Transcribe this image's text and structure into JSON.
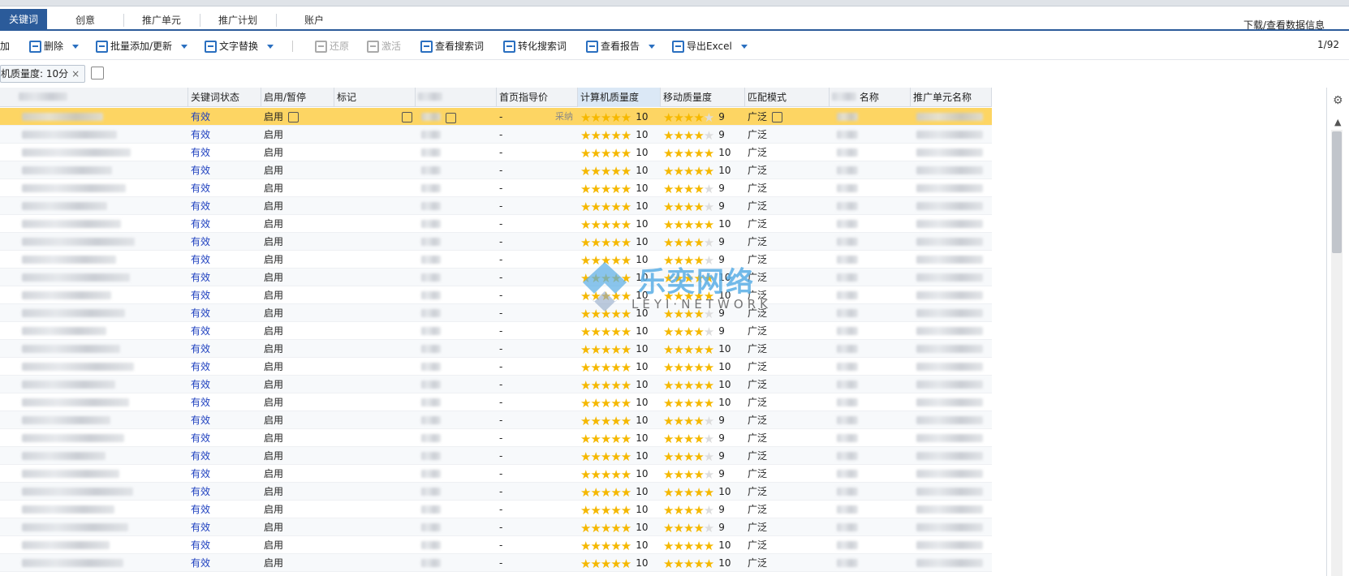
{
  "tabs": [
    {
      "label": "关键词",
      "active": true
    },
    {
      "label": "创意"
    },
    {
      "label": "推广单元"
    },
    {
      "label": "推广计划"
    },
    {
      "label": "账户"
    }
  ],
  "download_link": "下载/查看数据信息",
  "toolbar": {
    "add": "加",
    "delete": "删除",
    "batch_add": "批量添加/更新",
    "text_replace": "文字替换",
    "restore": "还原",
    "activate": "激活",
    "view_search": "查看搜索词",
    "convert_search": "转化搜索词",
    "view_report": "查看报告",
    "export": "导出Excel",
    "pager": "1/92"
  },
  "filter": {
    "chip": "机质量度: 10分",
    "close": "×"
  },
  "columns": {
    "status": "关键词状态",
    "enable": "启用/暂停",
    "mark": "标记",
    "bid_guide": "首页指导价",
    "pc_quality": "计算机质量度",
    "mobile_quality": "移动质量度",
    "match": "匹配模式",
    "plan": "名称",
    "unit": "推广单元名称"
  },
  "rows": [
    {
      "status": "有效",
      "enable": "启用",
      "bid": "-",
      "pc": 10,
      "mobile": 9,
      "match": "广泛",
      "selected": true,
      "note": "采纳"
    },
    {
      "status": "有效",
      "enable": "启用",
      "bid": "-",
      "pc": 10,
      "mobile": 9,
      "match": "广泛"
    },
    {
      "status": "有效",
      "enable": "启用",
      "bid": "-",
      "pc": 10,
      "mobile": 10,
      "match": "广泛"
    },
    {
      "status": "有效",
      "enable": "启用",
      "bid": "-",
      "pc": 10,
      "mobile": 10,
      "match": "广泛"
    },
    {
      "status": "有效",
      "enable": "启用",
      "bid": "-",
      "pc": 10,
      "mobile": 9,
      "match": "广泛"
    },
    {
      "status": "有效",
      "enable": "启用",
      "bid": "-",
      "pc": 10,
      "mobile": 9,
      "match": "广泛"
    },
    {
      "status": "有效",
      "enable": "启用",
      "bid": "-",
      "pc": 10,
      "mobile": 10,
      "match": "广泛"
    },
    {
      "status": "有效",
      "enable": "启用",
      "bid": "-",
      "pc": 10,
      "mobile": 9,
      "match": "广泛"
    },
    {
      "status": "有效",
      "enable": "启用",
      "bid": "-",
      "pc": 10,
      "mobile": 9,
      "match": "广泛"
    },
    {
      "status": "有效",
      "enable": "启用",
      "bid": "-",
      "pc": 10,
      "mobile": 10,
      "match": "广泛"
    },
    {
      "status": "有效",
      "enable": "启用",
      "bid": "-",
      "pc": 10,
      "mobile": 10,
      "match": "广泛"
    },
    {
      "status": "有效",
      "enable": "启用",
      "bid": "-",
      "pc": 10,
      "mobile": 9,
      "match": "广泛"
    },
    {
      "status": "有效",
      "enable": "启用",
      "bid": "-",
      "pc": 10,
      "mobile": 9,
      "match": "广泛"
    },
    {
      "status": "有效",
      "enable": "启用",
      "bid": "-",
      "pc": 10,
      "mobile": 10,
      "match": "广泛"
    },
    {
      "status": "有效",
      "enable": "启用",
      "bid": "-",
      "pc": 10,
      "mobile": 10,
      "match": "广泛"
    },
    {
      "status": "有效",
      "enable": "启用",
      "bid": "-",
      "pc": 10,
      "mobile": 10,
      "match": "广泛"
    },
    {
      "status": "有效",
      "enable": "启用",
      "bid": "-",
      "pc": 10,
      "mobile": 10,
      "match": "广泛"
    },
    {
      "status": "有效",
      "enable": "启用",
      "bid": "-",
      "pc": 10,
      "mobile": 9,
      "match": "广泛"
    },
    {
      "status": "有效",
      "enable": "启用",
      "bid": "-",
      "pc": 10,
      "mobile": 9,
      "match": "广泛"
    },
    {
      "status": "有效",
      "enable": "启用",
      "bid": "-",
      "pc": 10,
      "mobile": 9,
      "match": "广泛"
    },
    {
      "status": "有效",
      "enable": "启用",
      "bid": "-",
      "pc": 10,
      "mobile": 9,
      "match": "广泛"
    },
    {
      "status": "有效",
      "enable": "启用",
      "bid": "-",
      "pc": 10,
      "mobile": 10,
      "match": "广泛"
    },
    {
      "status": "有效",
      "enable": "启用",
      "bid": "-",
      "pc": 10,
      "mobile": 9,
      "match": "广泛"
    },
    {
      "status": "有效",
      "enable": "启用",
      "bid": "-",
      "pc": 10,
      "mobile": 9,
      "match": "广泛"
    },
    {
      "status": "有效",
      "enable": "启用",
      "bid": "-",
      "pc": 10,
      "mobile": 10,
      "match": "广泛"
    },
    {
      "status": "有效",
      "enable": "启用",
      "bid": "-",
      "pc": 10,
      "mobile": 10,
      "match": "广泛"
    }
  ],
  "watermark": {
    "cn": "乐奕网络",
    "en": "LEYI·NETWORK"
  },
  "colors": {
    "accent": "#2b5b9a",
    "selected_row": "#fdd563",
    "status_text": "#1d3fbf",
    "star": "#f5b800"
  },
  "icons": {
    "settings": "gear-icon",
    "scroll_up": "chevron-up-icon",
    "edit": "edit-icon"
  }
}
